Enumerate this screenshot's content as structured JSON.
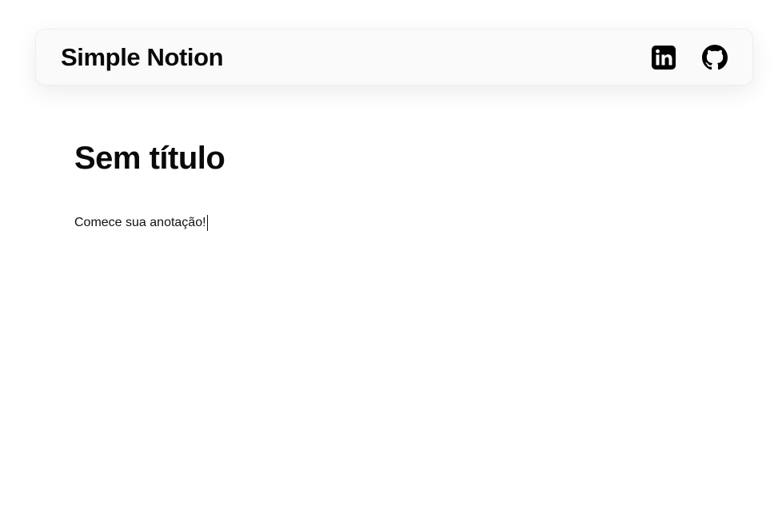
{
  "header": {
    "brand": "Simple Notion",
    "icons": {
      "linkedin": "linkedin-icon",
      "github": "github-icon"
    }
  },
  "document": {
    "title": "Sem título",
    "body": "Comece sua anotação!"
  },
  "colors": {
    "navbar_background": "#fafafa",
    "text": "#0a0a0a",
    "icon": "#000000",
    "page_background": "#ffffff"
  }
}
